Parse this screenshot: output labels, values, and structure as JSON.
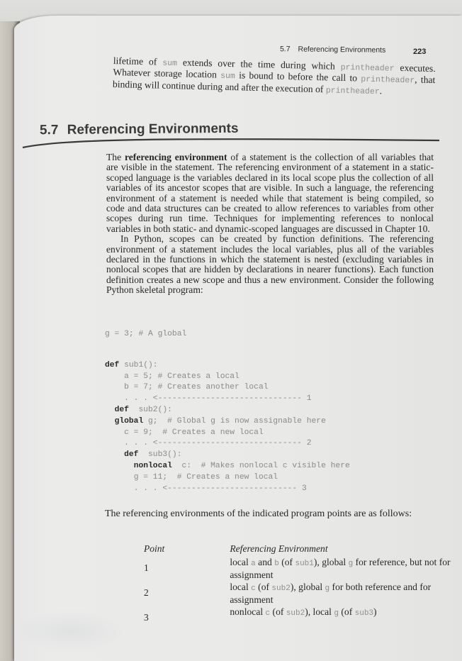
{
  "header": {
    "section_number": "5.7",
    "section_name": "Referencing Environments",
    "page_number": "223"
  },
  "top_paragraph": {
    "parts": [
      {
        "t": "lifetime of "
      },
      {
        "code": "sum"
      },
      {
        "t": " extends over the time during which "
      },
      {
        "code": "printheader"
      },
      {
        "t": " executes. Whatever storage location "
      },
      {
        "code": "sum"
      },
      {
        "t": " is bound to before the call to "
      },
      {
        "code": "printheader"
      },
      {
        "t": ", that binding will continue during and after the execution of "
      },
      {
        "code": "printheader"
      },
      {
        "t": "."
      }
    ]
  },
  "section": {
    "number": "5.7",
    "title": "Referencing Environments"
  },
  "body": {
    "p1_prefix": "The ",
    "p1_bold": "referencing environment",
    "p1_rest": " of a statement is the collection of all variables that are visible in the statement. The referencing environment of a statement in a static-scoped language is the variables declared in its local scope plus the collection of all variables of its ancestor scopes that are visible. In such a language, the referencing environment of a statement is needed while that statement is being compiled, so code and data structures can be created to allow references to variables from other scopes during run time. Techniques for implementing references to nonlocal variables in both static- and dynamic-scoped languages are discussed in Chapter 10.",
    "p2": "In Python, scopes can be created by function definitions. The referencing environment of a statement includes the local variables, plus all of the variables declared in the functions in which the statement is nested (excluding variables in nonlocal scopes that are hidden by declarations in nearer functions). Each function definition creates a new scope and thus a new environment. Consider the following Python skeletal program:"
  },
  "code": {
    "lines": [
      {
        "indent": "",
        "kw": "",
        "text": "g = 3; # A global"
      },
      {
        "gap": true
      },
      {
        "indent": "",
        "kw": "def",
        "text": " sub1():"
      },
      {
        "indent": "    ",
        "kw": "",
        "text": "a = 5; # Creates a local"
      },
      {
        "indent": "    ",
        "kw": "",
        "text": "b = 7; # Creates another local"
      },
      {
        "indent": "    ",
        "kw": "",
        "text": ". . . <------------------------------ 1"
      },
      {
        "indent": "  ",
        "kw": "def",
        "text": "  sub2():"
      },
      {
        "indent": "  ",
        "kw": "global",
        "text": " g;  # Global g is now assignable here"
      },
      {
        "indent": "    ",
        "kw": "",
        "text": "c = 9;  # Creates a new local"
      },
      {
        "indent": "    ",
        "kw": "",
        "text": ". . . <------------------------------ 2"
      },
      {
        "indent": "    ",
        "kw": "def",
        "text": "  sub3():"
      },
      {
        "indent": "      ",
        "kw": "nonlocal",
        "text": "  c:  # Makes nonlocal c visible here"
      },
      {
        "indent": "      ",
        "kw": "",
        "text": "g = 11;  # Creates a new local"
      },
      {
        "indent": "      ",
        "kw": "",
        "text": ". . . <--------------------------- 3"
      }
    ]
  },
  "table_intro": "The referencing environments of the indicated program points are as follows:",
  "ref_table": {
    "headers": [
      "Point",
      "Referencing Environment"
    ],
    "rows": [
      {
        "point": "1",
        "env": [
          {
            "t": "local "
          },
          {
            "code": "a"
          },
          {
            "t": " and "
          },
          {
            "code": "b"
          },
          {
            "t": " (of "
          },
          {
            "code": "sub1"
          },
          {
            "t": "), global "
          },
          {
            "code": "g"
          },
          {
            "t": " for reference, but not for assignment"
          }
        ]
      },
      {
        "point": "2",
        "env": [
          {
            "t": "local "
          },
          {
            "code": "c"
          },
          {
            "t": " (of "
          },
          {
            "code": "sub2"
          },
          {
            "t": "), global "
          },
          {
            "code": "g"
          },
          {
            "t": " for both reference and for assignment"
          }
        ]
      },
      {
        "point": "3",
        "env": [
          {
            "t": "nonlocal "
          },
          {
            "code": "c"
          },
          {
            "t": " (of "
          },
          {
            "code": "sub2"
          },
          {
            "t": "), local "
          },
          {
            "code": "g"
          },
          {
            "t": " (of "
          },
          {
            "code": "sub3"
          },
          {
            "t": ")"
          }
        ]
      }
    ]
  },
  "colors": {
    "page": "#e9e9e7",
    "text": "#262626",
    "code_text": "#8a8a8a",
    "keyword": "#2a2a2a",
    "heading": "#3b3b3b"
  }
}
